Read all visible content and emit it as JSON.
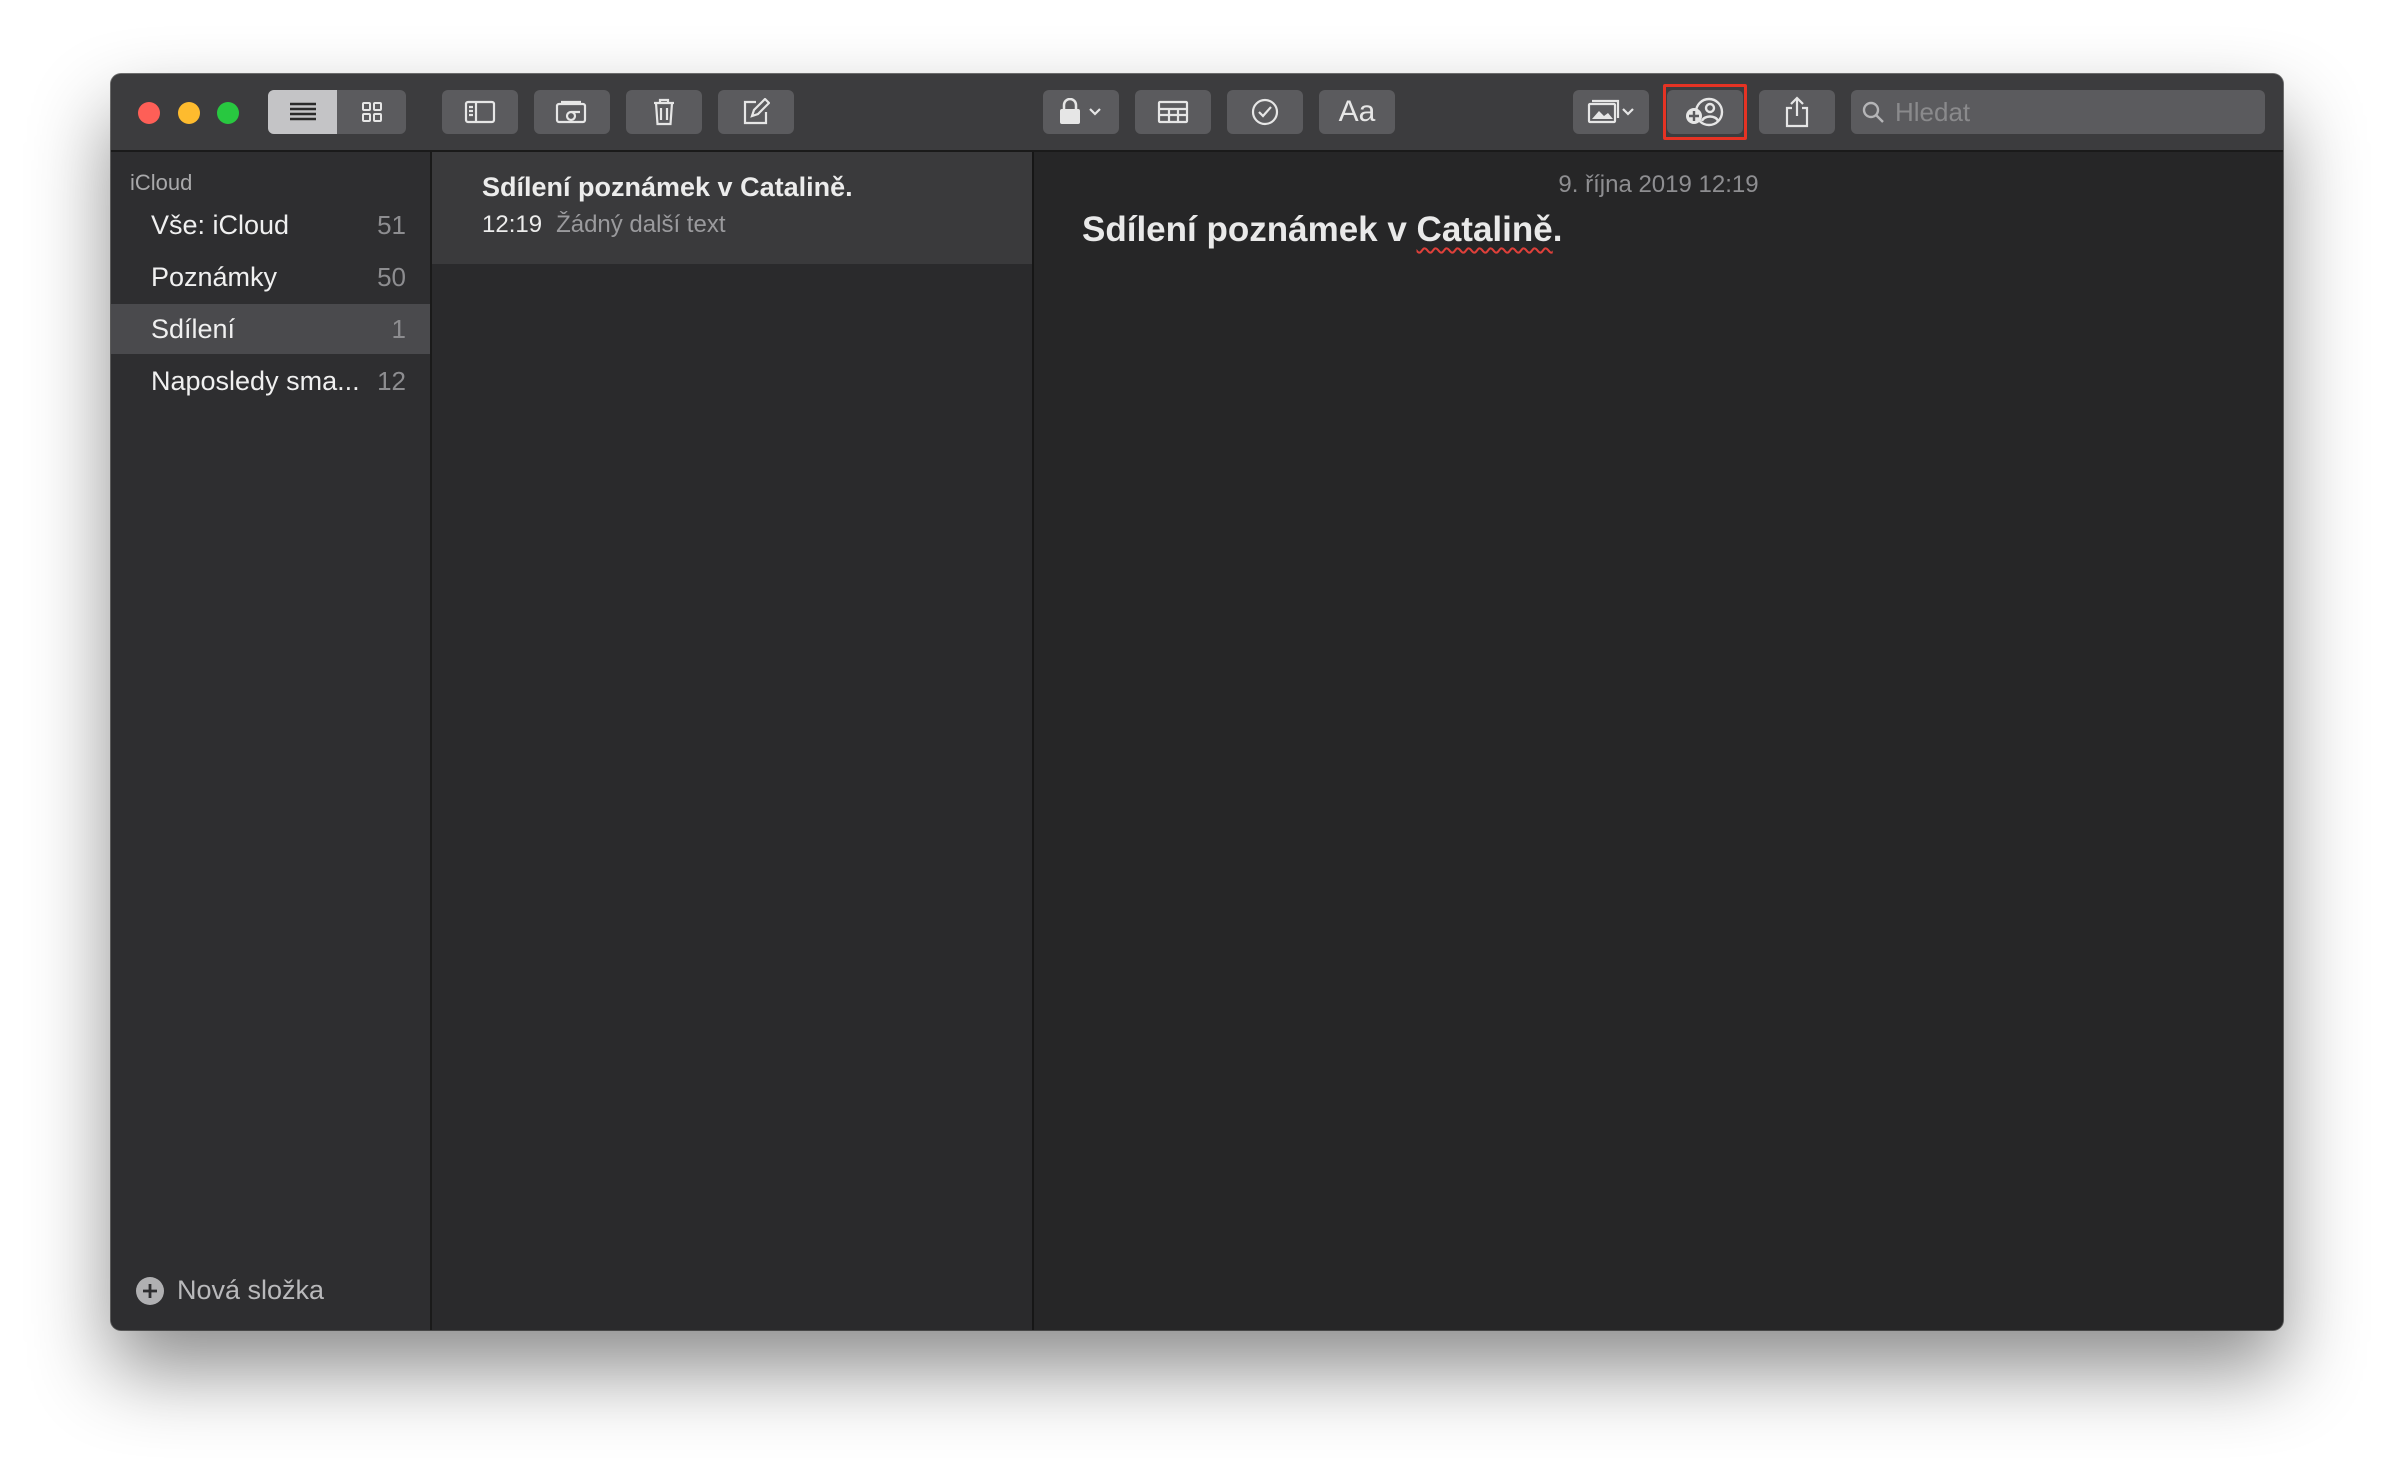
{
  "sidebar": {
    "section": "iCloud",
    "items": [
      {
        "label": "Vše: iCloud",
        "count": "51"
      },
      {
        "label": "Poznámky",
        "count": "50"
      },
      {
        "label": "Sdílení",
        "count": "1"
      },
      {
        "label": "Naposledy sma...",
        "count": "12"
      }
    ],
    "new_folder": "Nová složka"
  },
  "search": {
    "placeholder": "Hledat"
  },
  "toolbar": {
    "format_label": "Aa"
  },
  "list": {
    "note": {
      "title": "Sdílení poznámek v Catalině.",
      "time": "12:19",
      "preview": "Žádný další text"
    }
  },
  "editor": {
    "date": "9. října 2019 12:19",
    "title_part1": "Sdílení poznámek v ",
    "title_part2": "Catalině",
    "title_part3": "."
  },
  "colors": {
    "highlight": "#e53324",
    "close": "#fe5f57",
    "minimize": "#febb2e",
    "maximize": "#28c840"
  },
  "icons": [
    "list-view-icon",
    "gallery-view-icon",
    "sidebar-toggle-icon",
    "attachments-icon",
    "trash-icon",
    "compose-icon",
    "lock-icon",
    "table-icon",
    "checklist-icon",
    "media-icon",
    "add-people-icon",
    "share-icon",
    "search-icon",
    "plus-circle-icon"
  ]
}
